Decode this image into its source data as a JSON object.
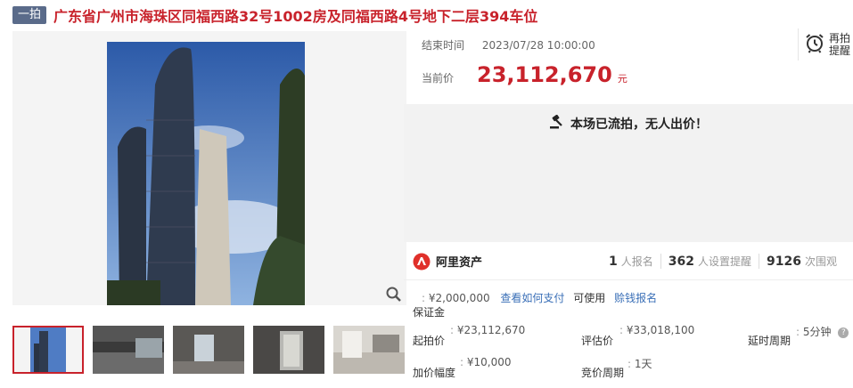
{
  "header": {
    "badge": "一拍",
    "title": "广东省广州市海珠区同福西路32号1002房及同福西路4号地下二层394车位"
  },
  "auction": {
    "end_time_label": "结束时间",
    "end_time": "2023/07/28 10:00:00",
    "current_price_label": "当前价",
    "current_price": "23,112,670",
    "price_unit": "元",
    "remind_label": "再拍提醒",
    "status": "本场已流拍，无人出价！"
  },
  "org": {
    "name": "阿里资产",
    "stats": [
      {
        "num": "1",
        "label": "人报名"
      },
      {
        "num": "362",
        "label": "人设置提醒"
      },
      {
        "num": "9126",
        "label": "次围观"
      }
    ]
  },
  "details": {
    "deposit_label": "保证金",
    "deposit": "¥2,000,000",
    "pay_link": "查看如何支付",
    "usable_text": "可使用",
    "credit_link": "赊钱报名",
    "start_price_label": "起拍价",
    "start_price": "¥23,112,670",
    "assess_label": "评估价",
    "assess": "¥33,018,100",
    "delay_label": "延时周期",
    "delay": "5分钟",
    "increment_label": "加价幅度",
    "increment": "¥10,000",
    "cycle_label": "竞价周期",
    "cycle": "1天",
    "colon": ":"
  },
  "colors": {
    "accent": "#c8222b",
    "link": "#3a6fb7",
    "badge": "#5a6b8a"
  },
  "icons": [
    "magnifier-icon",
    "alarm-clock-icon",
    "gavel-icon",
    "ali-assets-logo",
    "help-icon"
  ]
}
